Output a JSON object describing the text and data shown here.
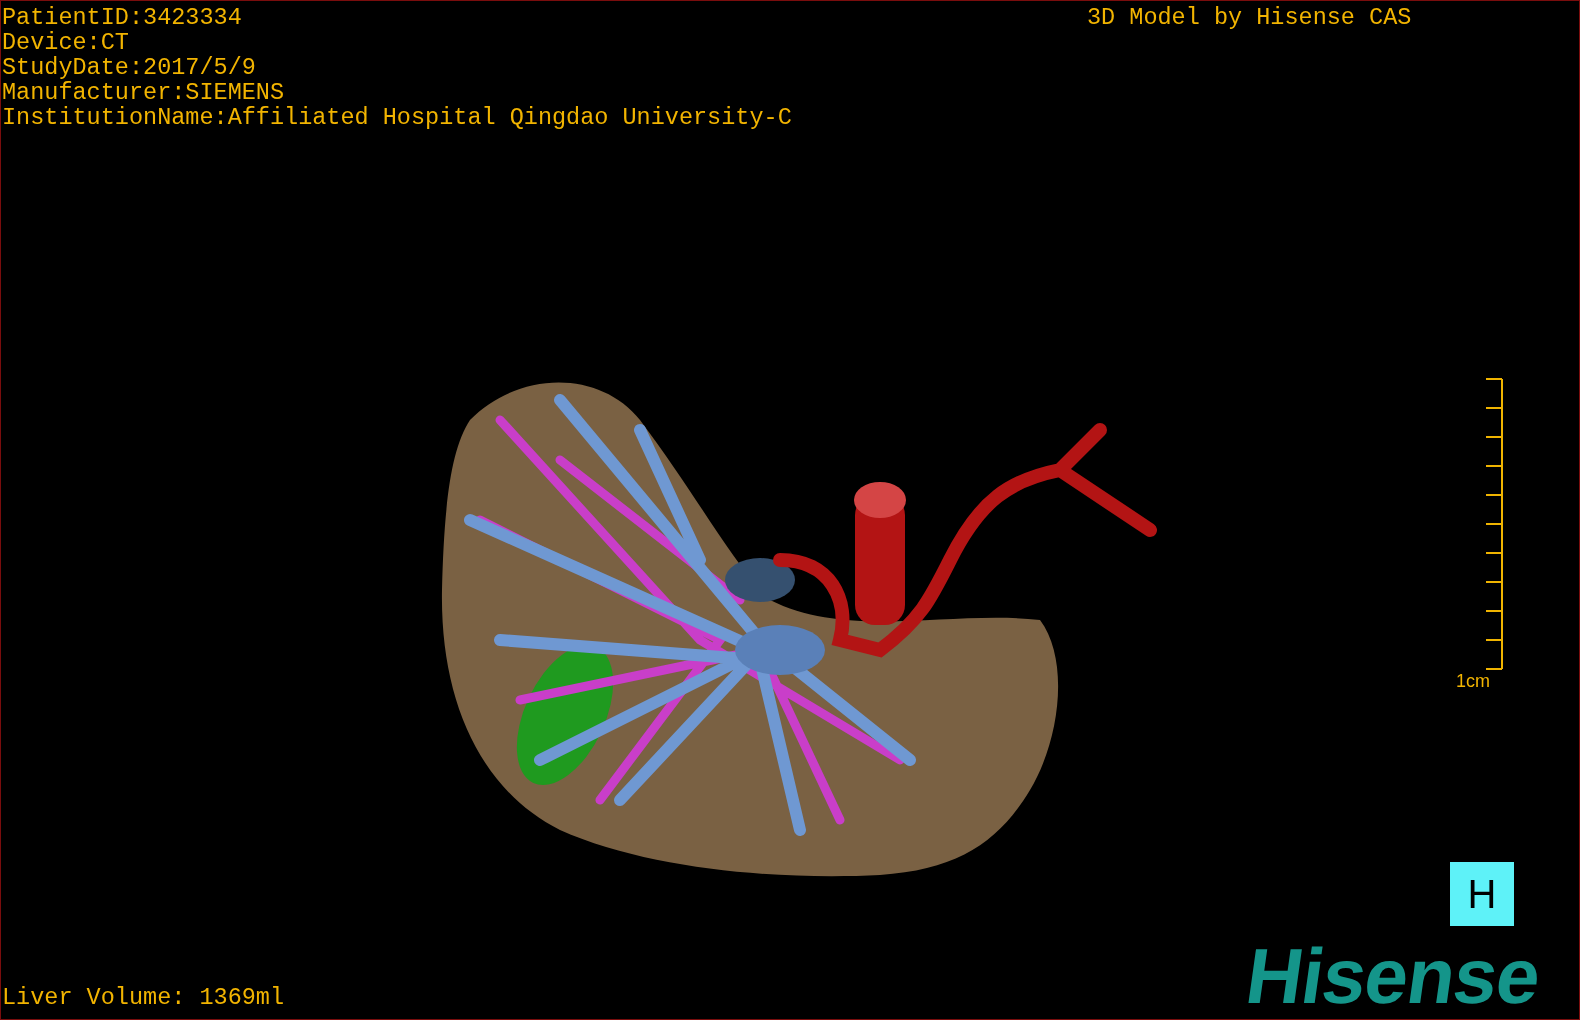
{
  "info_lines": [
    "PatientID:3423334",
    "Device:CT",
    "StudyDate:2017/5/9",
    "Manufacturer:SIEMENS",
    "InstitutionName:Affiliated Hospital Qingdao University-C"
  ],
  "title": "3D Model by Hisense CAS",
  "scale_bar": {
    "label": "1cm"
  },
  "orientation_marker": "H",
  "logo": "Hisense",
  "liver_volume": "Liver Volume: 1369ml"
}
